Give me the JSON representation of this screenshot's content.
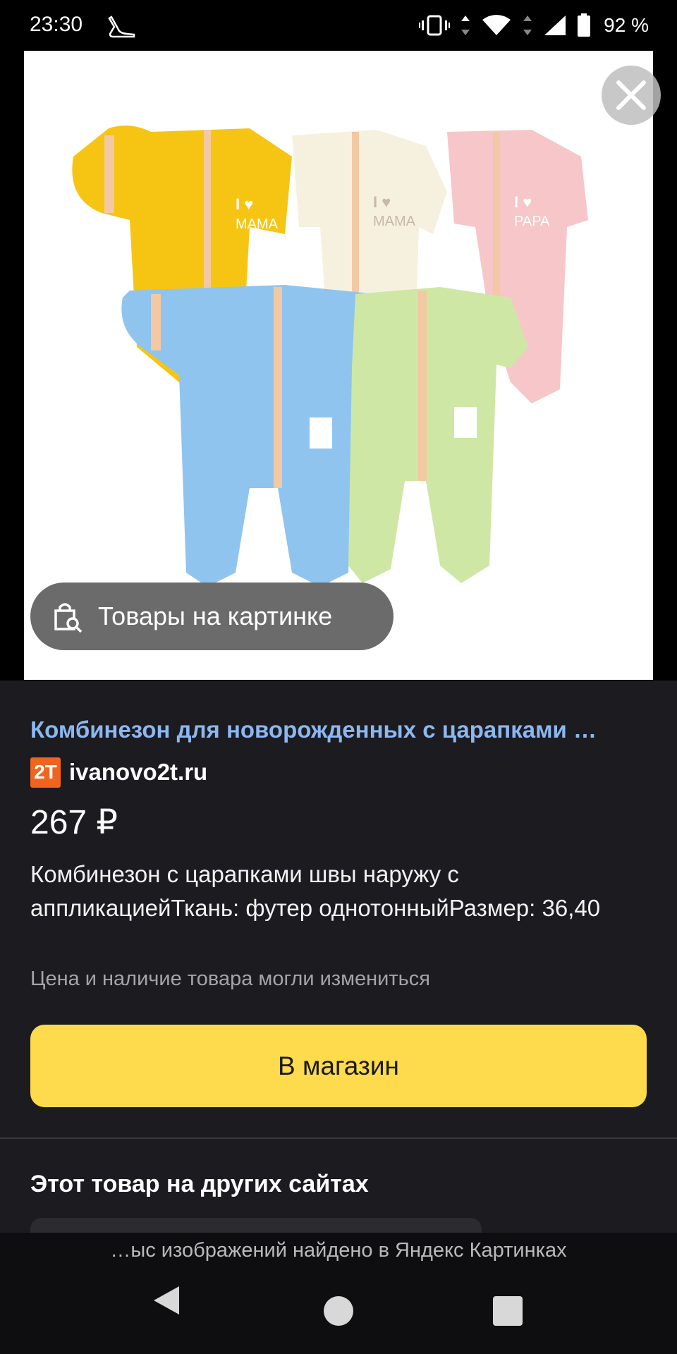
{
  "status_bar": {
    "time": "23:30",
    "battery": "92 %",
    "icons": [
      "vibrate-icon",
      "wifi-icon",
      "signal-icon",
      "battery-icon"
    ]
  },
  "image_viewer": {
    "products_chip_label": "Товары на картинке",
    "close_icon": "close-icon",
    "product_image": {
      "rompers": [
        {
          "color": "#f6c514",
          "print": "I ♥ MAMA"
        },
        {
          "color": "#f6f1df",
          "print": "I ♥ MAMA"
        },
        {
          "color": "#f6c6c9",
          "print": "I ♥ PAPA"
        },
        {
          "color": "#8fc4ee",
          "print": ""
        },
        {
          "color": "#cfe7a4",
          "print": ""
        }
      ]
    }
  },
  "product": {
    "title": "Комбинезон для новорожденных с царапками …",
    "site_favicon": "2T",
    "site_name": "ivanovo2t.ru",
    "price": "267 ₽",
    "description": "Комбинезон с царапками швы наружу с аппликациейТкань: футер однотонныйРазмер: 36,40",
    "disclaimer": "Цена и наличие товара могли измениться",
    "shop_button_label": "В магазин"
  },
  "other_sites": {
    "heading": "Этот товар на других сайтах"
  },
  "footer": {
    "note": "…ыс изображений найдено в Яндекс Картинках"
  },
  "colors": {
    "accent_button": "#fedb4d",
    "link": "#8bb8f2",
    "panel_bg": "#1c1b1f"
  }
}
